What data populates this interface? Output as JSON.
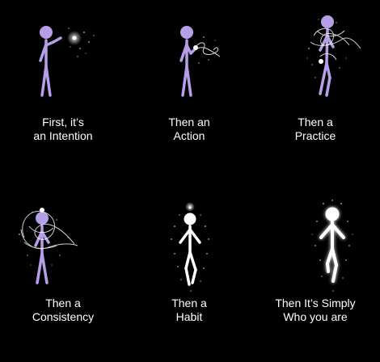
{
  "panels": [
    {
      "id": "intention",
      "line1": "First, it’s",
      "line2": "an Intention"
    },
    {
      "id": "action",
      "line1": "Then an",
      "line2": "Action"
    },
    {
      "id": "practice",
      "line1": "Then a",
      "line2": "Practice"
    },
    {
      "id": "consistency",
      "line1": "Then a",
      "line2": "Consistency"
    },
    {
      "id": "habit",
      "line1": "Then a",
      "line2": "Habit"
    },
    {
      "id": "identity",
      "line1": "Then It’s Simply",
      "line2": "Who you are"
    }
  ],
  "colors": {
    "background": "#000000",
    "figure_purple": "#b79ee8",
    "figure_white": "#ffffff",
    "caption": "#ffffff"
  }
}
